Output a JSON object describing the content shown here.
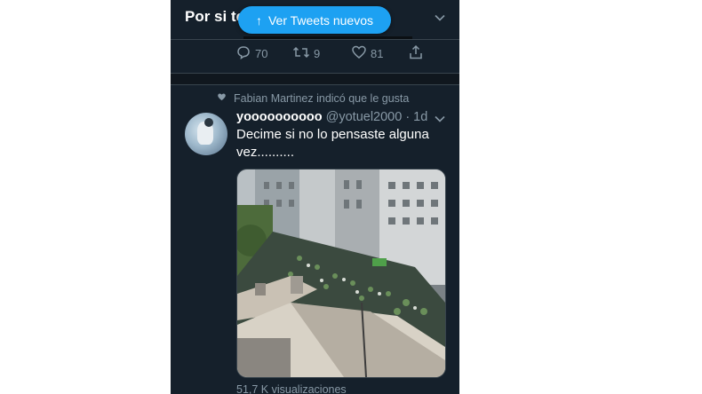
{
  "timeline": {
    "section_title": "Por si te",
    "new_tweets_label": "Ver Tweets nuevos"
  },
  "prev_tweet": {
    "replies": "70",
    "retweets": "9",
    "likes": "81"
  },
  "tweet": {
    "social_context": "Fabian Martinez indicó que le gusta",
    "display_name": "yoooooooooo",
    "handle": "@yotuel2000",
    "time": "· 1d",
    "text": "Decime si no lo pensaste alguna vez..........",
    "views": "51,7 K visualizaciones"
  },
  "colors": {
    "background": "#15202b",
    "accent": "#1da1f2",
    "muted": "#8899a6"
  }
}
